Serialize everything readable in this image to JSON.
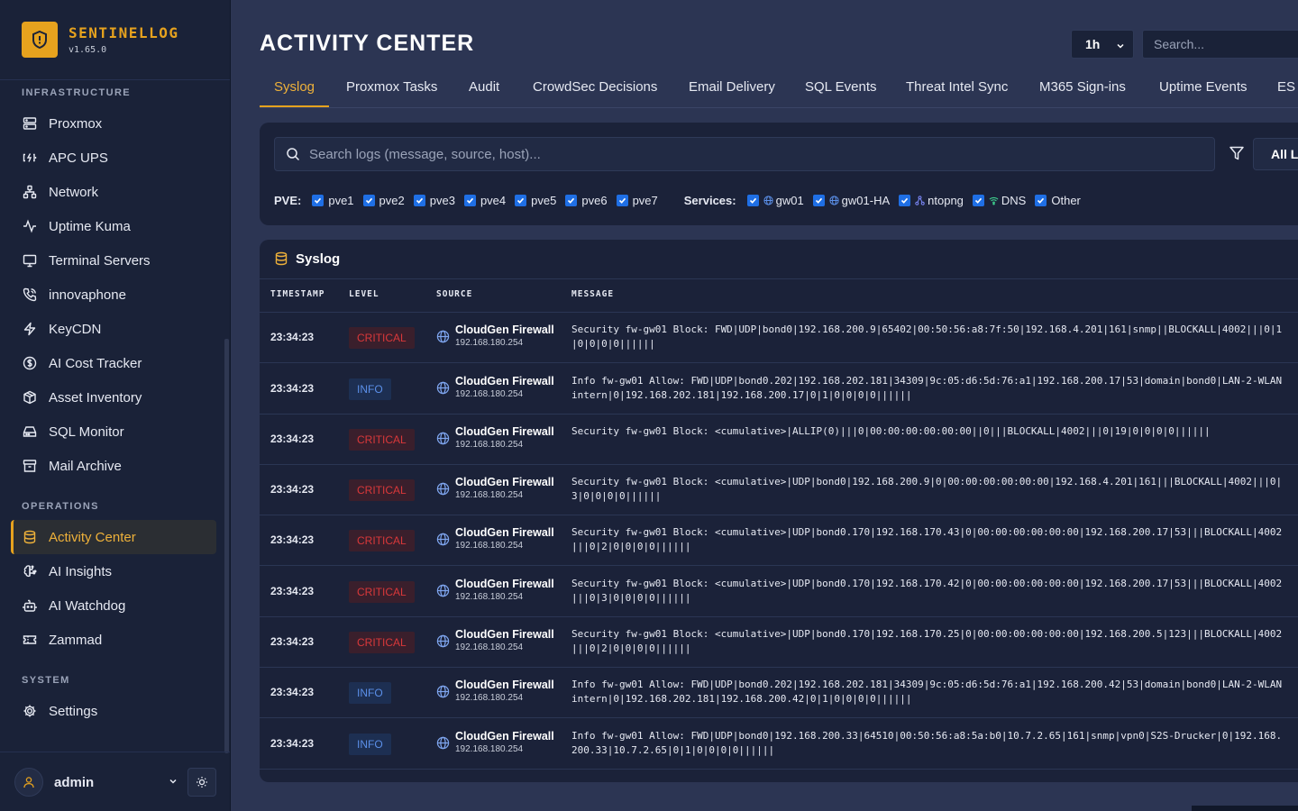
{
  "app": {
    "name": "SENTINELLOG",
    "version": "v1.65.0"
  },
  "sidebar": {
    "sections": [
      {
        "title": "INFRASTRUCTURE"
      },
      {
        "title": "OPERATIONS"
      },
      {
        "title": "SYSTEM"
      }
    ],
    "items": [
      {
        "label": "Proxmox",
        "icon": "server-icon"
      },
      {
        "label": "APC UPS",
        "icon": "battery-charging-icon"
      },
      {
        "label": "Network",
        "icon": "network-icon"
      },
      {
        "label": "Uptime Kuma",
        "icon": "activity-pulse-icon"
      },
      {
        "label": "Terminal Servers",
        "icon": "monitor-icon"
      },
      {
        "label": "innovaphone",
        "icon": "phone-icon"
      },
      {
        "label": "KeyCDN",
        "icon": "zap-icon"
      },
      {
        "label": "AI Cost Tracker",
        "icon": "dollar-circle-icon"
      },
      {
        "label": "Asset Inventory",
        "icon": "package-icon"
      },
      {
        "label": "SQL Monitor",
        "icon": "hard-drive-icon"
      },
      {
        "label": "Mail Archive",
        "icon": "archive-icon"
      },
      {
        "label": "Activity Center",
        "icon": "database-icon",
        "active": true
      },
      {
        "label": "AI Insights",
        "icon": "brain-icon"
      },
      {
        "label": "AI Watchdog",
        "icon": "bot-icon"
      },
      {
        "label": "Zammad",
        "icon": "ticket-icon"
      },
      {
        "label": "Settings",
        "icon": "gear-icon"
      }
    ],
    "user": {
      "name": "admin"
    }
  },
  "header": {
    "title": "ACTIVITY CENTER",
    "time_range": "1h",
    "search_placeholder": "Search..."
  },
  "tabs": [
    {
      "label": "Syslog",
      "active": true
    },
    {
      "label": "Proxmox Tasks"
    },
    {
      "label": "Audit"
    },
    {
      "label": "CrowdSec Decisions"
    },
    {
      "label": "Email Delivery"
    },
    {
      "label": "SQL Events"
    },
    {
      "label": "Threat Intel Sync"
    },
    {
      "label": "M365 Sign-ins"
    },
    {
      "label": "Uptime Events"
    },
    {
      "label": "ES"
    }
  ],
  "filters": {
    "search_placeholder": "Search logs (message, source, host)...",
    "all_button": "All L",
    "pve_label": "PVE:",
    "pve_nodes": [
      "pve1",
      "pve2",
      "pve3",
      "pve4",
      "pve5",
      "pve6",
      "pve7"
    ],
    "services_label": "Services:",
    "services": [
      {
        "label": "gw01",
        "icon": "globe-icon"
      },
      {
        "label": "gw01-HA",
        "icon": "globe-icon"
      },
      {
        "label": "ntopng",
        "icon": "network-icon"
      },
      {
        "label": "DNS",
        "icon": "wifi-icon"
      },
      {
        "label": "Other",
        "icon": ""
      }
    ]
  },
  "syslog": {
    "title": "Syslog",
    "columns": [
      "TIMESTAMP",
      "LEVEL",
      "SOURCE",
      "MESSAGE"
    ],
    "rows": [
      {
        "timestamp": "23:34:23",
        "level": "CRITICAL",
        "source": "CloudGen Firewall",
        "ip": "192.168.180.254",
        "message": "Security fw-gw01 Block: FWD|UDP|bond0|192.168.200.9|65402|00:50:56:a8:7f:50|192.168.4.201|161|snmp||BLOCKALL|4002|||0|1|0|0|0|0||||||"
      },
      {
        "timestamp": "23:34:23",
        "level": "INFO",
        "source": "CloudGen Firewall",
        "ip": "192.168.180.254",
        "message": "Info fw-gw01 Allow: FWD|UDP|bond0.202|192.168.202.181|34309|9c:05:d6:5d:76:a1|192.168.200.17|53|domain|bond0|LAN-2-WLANintern|0|192.168.202.181|192.168.200.17|0|1|0|0|0|0||||||"
      },
      {
        "timestamp": "23:34:23",
        "level": "CRITICAL",
        "source": "CloudGen Firewall",
        "ip": "192.168.180.254",
        "message": "Security fw-gw01 Block: <cumulative>|ALLIP(0)|||0|00:00:00:00:00:00||0|||BLOCKALL|4002|||0|19|0|0|0|0||||||"
      },
      {
        "timestamp": "23:34:23",
        "level": "CRITICAL",
        "source": "CloudGen Firewall",
        "ip": "192.168.180.254",
        "message": "Security fw-gw01 Block: <cumulative>|UDP|bond0|192.168.200.9|0|00:00:00:00:00:00|192.168.4.201|161|||BLOCKALL|4002|||0|3|0|0|0|0||||||"
      },
      {
        "timestamp": "23:34:23",
        "level": "CRITICAL",
        "source": "CloudGen Firewall",
        "ip": "192.168.180.254",
        "message": "Security fw-gw01 Block: <cumulative>|UDP|bond0.170|192.168.170.43|0|00:00:00:00:00:00|192.168.200.17|53|||BLOCKALL|4002|||0|2|0|0|0|0||||||"
      },
      {
        "timestamp": "23:34:23",
        "level": "CRITICAL",
        "source": "CloudGen Firewall",
        "ip": "192.168.180.254",
        "message": "Security fw-gw01 Block: <cumulative>|UDP|bond0.170|192.168.170.42|0|00:00:00:00:00:00|192.168.200.17|53|||BLOCKALL|4002|||0|3|0|0|0|0||||||"
      },
      {
        "timestamp": "23:34:23",
        "level": "CRITICAL",
        "source": "CloudGen Firewall",
        "ip": "192.168.180.254",
        "message": "Security fw-gw01 Block: <cumulative>|UDP|bond0.170|192.168.170.25|0|00:00:00:00:00:00|192.168.200.5|123|||BLOCKALL|4002|||0|2|0|0|0|0||||||"
      },
      {
        "timestamp": "23:34:23",
        "level": "INFO",
        "source": "CloudGen Firewall",
        "ip": "192.168.180.254",
        "message": "Info fw-gw01 Allow: FWD|UDP|bond0.202|192.168.202.181|34309|9c:05:d6:5d:76:a1|192.168.200.42|53|domain|bond0|LAN-2-WLANintern|0|192.168.202.181|192.168.200.42|0|1|0|0|0|0||||||"
      },
      {
        "timestamp": "23:34:23",
        "level": "INFO",
        "source": "CloudGen Firewall",
        "ip": "192.168.180.254",
        "message": "Info fw-gw01 Allow: FWD|UDP|bond0|192.168.200.33|64510|00:50:56:a8:5a:b0|10.7.2.65|161|snmp|vpn0|S2S-Drucker|0|192.168.200.33|10.7.2.65|0|1|0|0|0|0||||||"
      }
    ]
  },
  "colors": {
    "accent": "#e6a21e",
    "critical": "#d9383a",
    "info": "#5b8fe8",
    "checkbox": "#1f6fe5"
  }
}
